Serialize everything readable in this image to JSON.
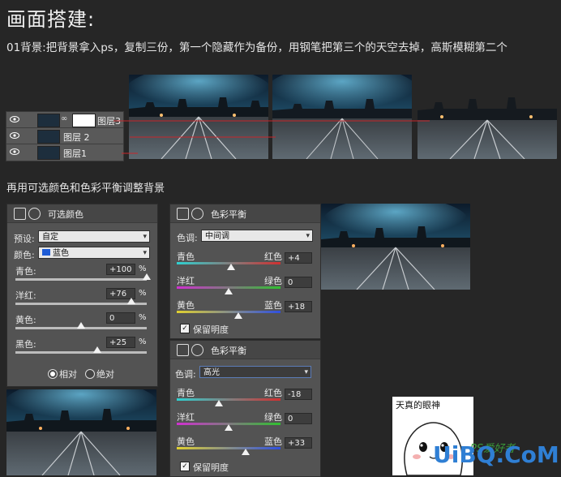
{
  "title": "画面搭建:",
  "intro": "01背景:把背景拿入ps，复制三份，第一个隐藏作为备份，用钢笔把第三个的天空去掉，高斯模糊第二个",
  "section2": "再用可选颜色和色彩平衡调整背景",
  "layers": [
    {
      "name": "图层3",
      "has_mask": true
    },
    {
      "name": "图层 2",
      "has_mask": false
    },
    {
      "name": "图层1",
      "has_mask": false
    }
  ],
  "selective_color": {
    "title": "可选颜色",
    "preset_label": "预设:",
    "preset_value": "自定",
    "colors_label": "颜色:",
    "colors_value": "蓝色",
    "sliders": [
      {
        "label": "青色:",
        "value": "+100",
        "unit": "%",
        "level": 1.0
      },
      {
        "label": "洋红:",
        "value": "+76",
        "unit": "%",
        "level": 0.88
      },
      {
        "label": "黄色:",
        "value": "0",
        "unit": "%",
        "level": 0.5
      },
      {
        "label": "黑色:",
        "value": "+25",
        "unit": "%",
        "level": 0.625
      }
    ],
    "radio_relative": "相对",
    "radio_absolute": "绝对"
  },
  "color_balance_1": {
    "title": "色彩平衡",
    "tone_label": "色调:",
    "tone_value": "中间调",
    "rows": [
      {
        "left": "青色",
        "right": "红色",
        "value": "+4",
        "level": 0.52
      },
      {
        "left": "洋红",
        "right": "绿色",
        "value": "0",
        "level": 0.5
      },
      {
        "left": "黄色",
        "right": "蓝色",
        "value": "+18",
        "level": 0.59
      }
    ],
    "preserve": "保留明度"
  },
  "color_balance_2": {
    "title": "色彩平衡",
    "tone_label": "色调:",
    "tone_value": "高光",
    "rows": [
      {
        "left": "青色",
        "right": "红色",
        "value": "-18",
        "level": 0.41
      },
      {
        "left": "洋红",
        "right": "绿色",
        "value": "0",
        "level": 0.5
      },
      {
        "left": "黄色",
        "right": "蓝色",
        "value": "+33",
        "level": 0.665
      }
    ],
    "preserve": "保留明度"
  },
  "mascot_caption": "天真的眼神",
  "logo_text": "UiBQ.CoM",
  "logo_sub": "PS爱好者",
  "colors": {
    "background": "#262626",
    "panel": "#535353",
    "logo": "#2f7fd4"
  }
}
